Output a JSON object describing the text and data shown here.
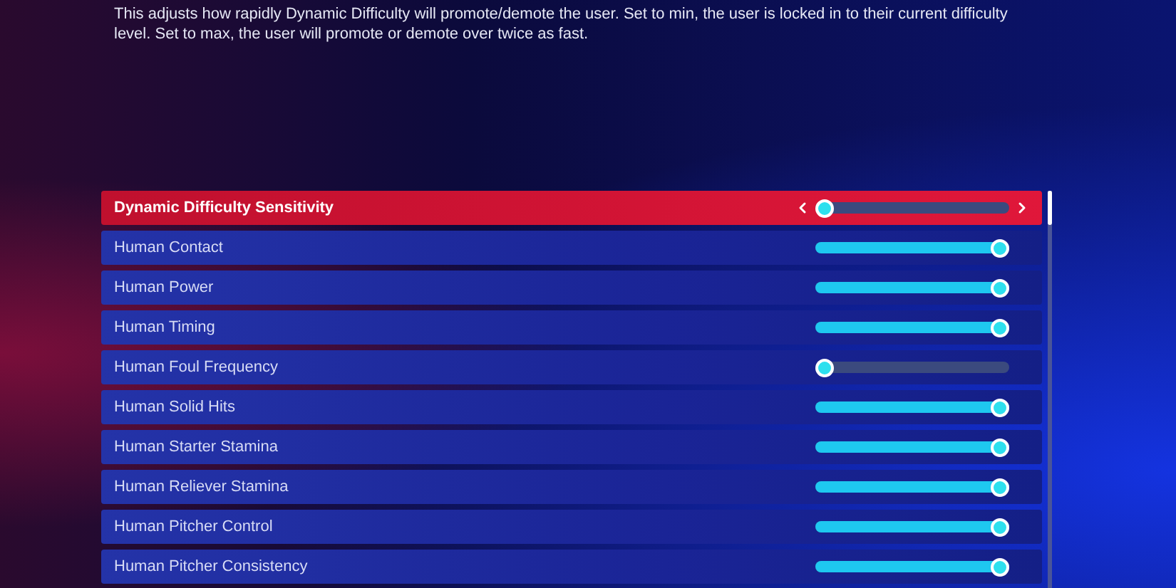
{
  "description": "This adjusts how rapidly Dynamic Difficulty will promote/demote the user. Set to min, the user is locked in to their current difficulty level. Set to max, the user will promote or demote over twice as fast.",
  "settings": [
    {
      "label": "Dynamic Difficulty Sensitivity",
      "selected": true,
      "level": 0
    },
    {
      "label": "Human Contact",
      "selected": false,
      "level": 1
    },
    {
      "label": "Human Power",
      "selected": false,
      "level": 1
    },
    {
      "label": "Human Timing",
      "selected": false,
      "level": 1
    },
    {
      "label": "Human Foul Frequency",
      "selected": false,
      "level": 0
    },
    {
      "label": "Human Solid Hits",
      "selected": false,
      "level": 1
    },
    {
      "label": "Human Starter Stamina",
      "selected": false,
      "level": 1
    },
    {
      "label": "Human Reliever Stamina",
      "selected": false,
      "level": 1
    },
    {
      "label": "Human Pitcher Control",
      "selected": false,
      "level": 1
    },
    {
      "label": "Human Pitcher Consistency",
      "selected": false,
      "level": 1
    }
  ]
}
